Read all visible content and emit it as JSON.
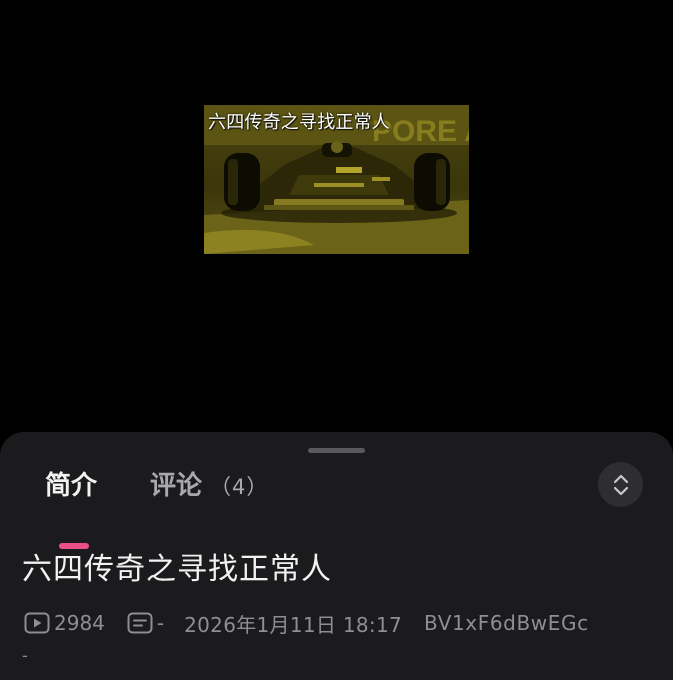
{
  "video": {
    "caption": "六四传奇之寻找正常人",
    "thumbnail_icon": "f1-race-car-image",
    "thumbnail_tint": "#c8b400"
  },
  "sheet": {
    "tabs": [
      {
        "label": "简介",
        "active": true
      },
      {
        "label": "评论",
        "count": "（4）",
        "active": false
      }
    ],
    "accent_color": "#ea4f87",
    "expand_icon": "expand-collapse-icon",
    "title": "六四传奇之寻找正常人",
    "meta": {
      "views_icon": "play-count-icon",
      "views": "2984",
      "danmaku_icon": "danmaku-icon",
      "danmaku": "-",
      "date": "2026年1月11日 18:17",
      "bvid": "BV1xF6dBwEGc"
    },
    "description": "-"
  }
}
